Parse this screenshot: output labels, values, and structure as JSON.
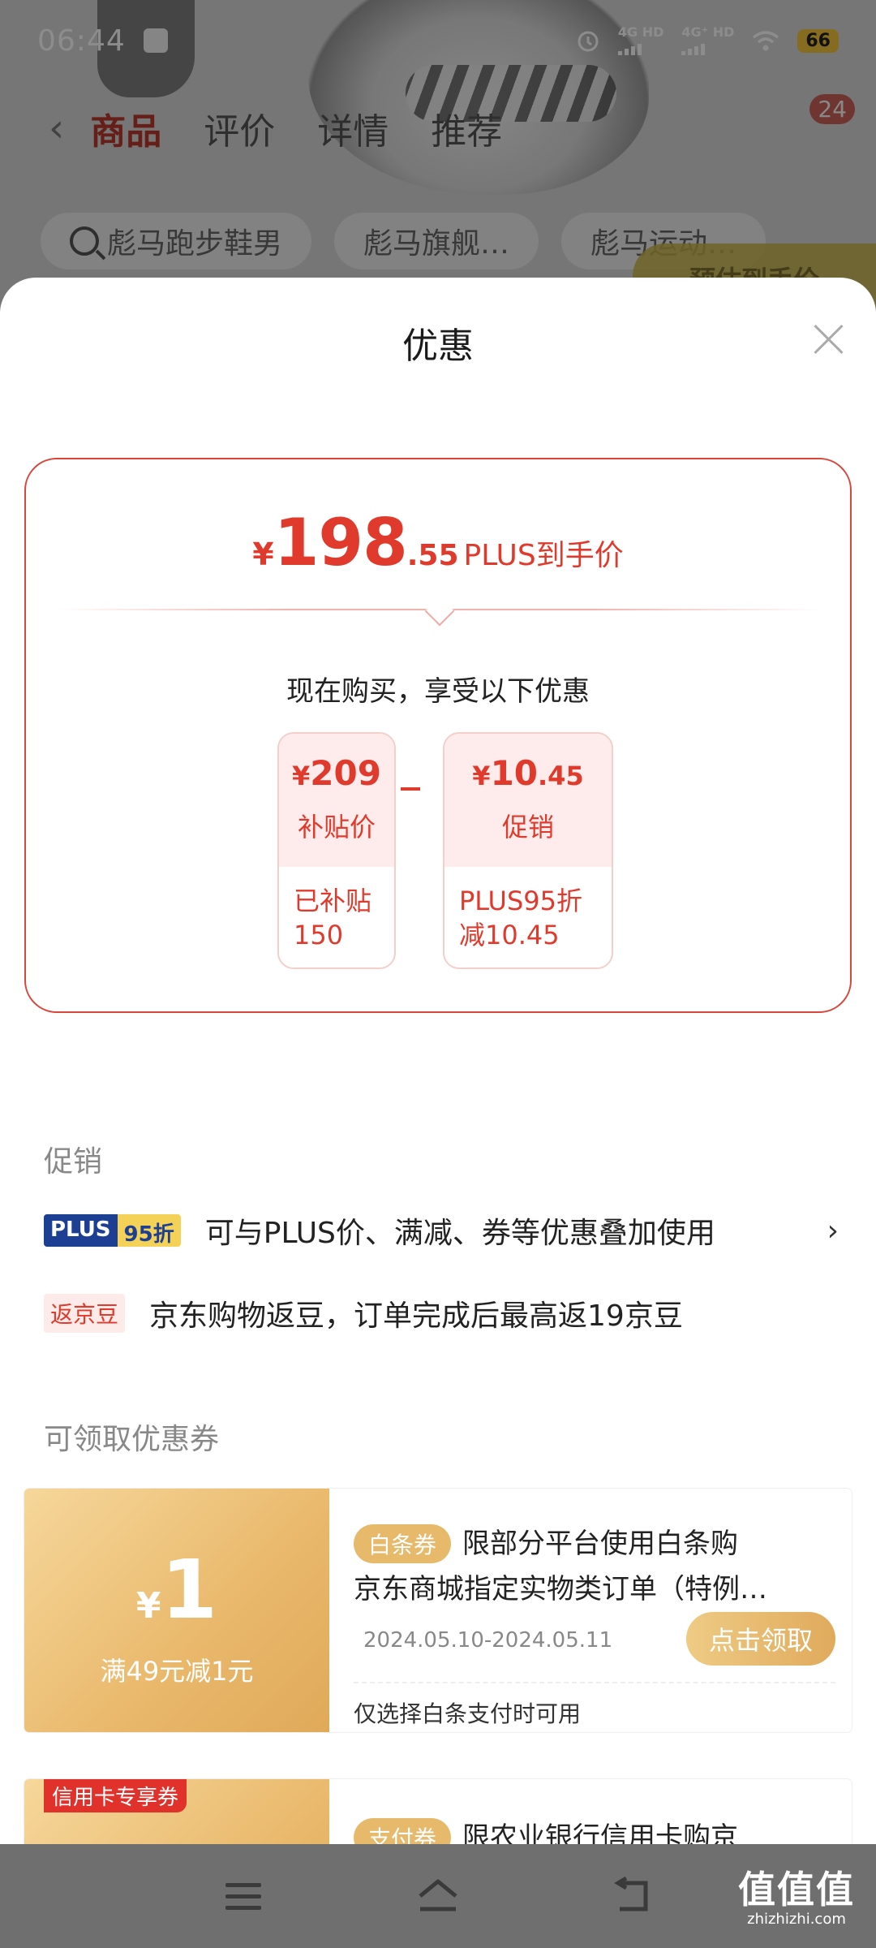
{
  "status_bar": {
    "time": "06:44",
    "net1": "4G HD",
    "net2": "4G⁺ HD",
    "battery": "66"
  },
  "background": {
    "tabs": [
      "商品",
      "评价",
      "详情",
      "推荐"
    ],
    "cart_badge": "24",
    "chips": [
      "彪马跑步鞋男",
      "彪马旗舰…",
      "彪马运动…"
    ],
    "yellow_tag": "预估到手价"
  },
  "sheet": {
    "title": "优惠",
    "price": {
      "currency": "¥",
      "integer": "198",
      "decimal": ".55",
      "label": "PLUS到手价"
    },
    "enjoy_text": "现在购买，享受以下优惠",
    "calc": [
      {
        "yen": "¥",
        "amount": "209",
        "amount_small": "",
        "name": "补贴价",
        "detail": "已补贴\n150"
      },
      {
        "yen": "¥",
        "amount": "10",
        "amount_small": ".45",
        "name": "促销",
        "detail": "PLUS95折\n减10.45"
      }
    ],
    "promo_section_title": "促销",
    "promo_plus": {
      "badge_left": "PLUS",
      "badge_right": "95折",
      "text": "可与PLUS价、满减、券等优惠叠加使用"
    },
    "promo_bean": {
      "badge": "返京豆",
      "text": "京东购物返豆，订单完成后最高返19京豆"
    },
    "coupon_section_title": "可领取优惠券",
    "coupons": [
      {
        "yen": "¥",
        "amount": "1",
        "condition": "满49元减1元",
        "tag": "白条券",
        "line1": "限部分平台使用白条购",
        "line2": "京东商城指定实物类订单（特例…",
        "date": "2024.05.10-2024.05.11",
        "button": "点击领取",
        "note": "仅选择白条支付时可用"
      },
      {
        "ribbon": "信用卡专享券",
        "tag": "支付券",
        "line1": "限农业银行信用卡购京"
      }
    ]
  },
  "watermark": {
    "big": "值值值",
    "small": "zhizhizhi.com"
  }
}
